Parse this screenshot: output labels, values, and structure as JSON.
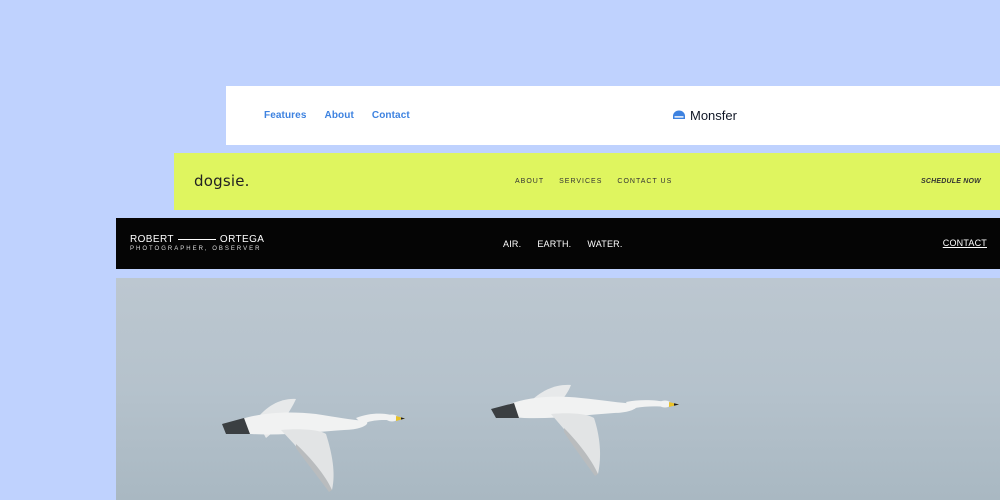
{
  "monsfer": {
    "nav_links": [
      "Features",
      "About",
      "Contact"
    ],
    "brand_name": "Monsfer",
    "link_color": "#3d82e0",
    "logo_icon": "half-dome-logo-icon"
  },
  "dogsie": {
    "brand_name": "dogsie.",
    "nav_links": [
      "ABOUT",
      "SERVICES",
      "CONTACT US"
    ],
    "cta_label": "SCHEDULE NOW",
    "background_color": "#dff55f"
  },
  "robert": {
    "first_name": "ROBERT",
    "last_name": "ORTEGA",
    "tagline": "PHOTOGRAPHER, OBSERVER",
    "nav_links": [
      "AIR.",
      "EARTH.",
      "WATER."
    ],
    "contact_label": "CONTACT",
    "background_color": "#050505"
  },
  "hero": {
    "subject": "two-swans-in-flight-photo"
  }
}
